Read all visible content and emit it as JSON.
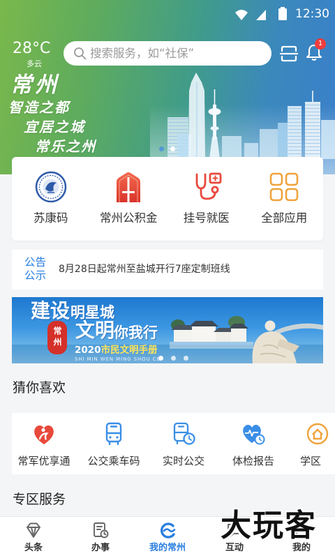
{
  "status_bar": {
    "time": "12:30",
    "icons": [
      "wifi-icon",
      "signal-icon",
      "battery-icon"
    ]
  },
  "header": {
    "temperature": "28°C",
    "weather": "多云",
    "search_placeholder": "搜索服务，如“社保”",
    "search_icon": "search-icon",
    "scan_icon": "scan-icon",
    "bell_icon": "bell-icon",
    "notification_count": "1"
  },
  "hero": {
    "title": "常州",
    "slogans": [
      "智造之都",
      "宜居之城",
      "常乐之州"
    ],
    "carousel": {
      "slides": 2,
      "active": 1
    }
  },
  "quick_apps": [
    {
      "label": "苏康码",
      "icon": "sukang-code-icon"
    },
    {
      "label": "常州公积金",
      "icon": "housing-fund-icon"
    },
    {
      "label": "挂号就医",
      "icon": "stethoscope-icon"
    },
    {
      "label": "全部应用",
      "icon": "all-apps-icon"
    }
  ],
  "notice": {
    "tag": [
      "公告",
      "公示"
    ],
    "text": "8月28日起常州至盐城开行7座定制班线"
  },
  "banner": {
    "headline_big_1": "建设",
    "headline_small_1": "明星城",
    "headline_big_2": "文明",
    "headline_small_2": "你我行",
    "seal": "常州",
    "year": "2020",
    "subtitle": "市民文明手册",
    "pinyin": "SHI MIN WEN MING SHOU CE",
    "carousel": {
      "slides": 3,
      "active": 0
    }
  },
  "guess": {
    "title": "猜你喜欢",
    "items": [
      {
        "label": "常军优享通",
        "icon": "military-heart-icon"
      },
      {
        "label": "公交乘车码",
        "icon": "bus-icon"
      },
      {
        "label": "实时公交",
        "icon": "realtime-bus-icon"
      },
      {
        "label": "体检报告",
        "icon": "health-report-icon"
      },
      {
        "label": "学区",
        "icon": "school-district-icon"
      }
    ]
  },
  "zone": {
    "title": "专区服务"
  },
  "tabbar": {
    "active": 2,
    "items": [
      {
        "label": "头条",
        "icon": "headline-icon"
      },
      {
        "label": "办事",
        "icon": "affairs-icon"
      },
      {
        "label": "我的常州",
        "icon": "changzhou-logo-icon"
      },
      {
        "label": "互动",
        "icon": "interaction-icon"
      },
      {
        "label": "我的",
        "icon": "profile-icon"
      }
    ]
  },
  "watermark": "大玩客",
  "colors": {
    "accent": "#2a7fe0",
    "badge": "#f03d3d",
    "page_bg": "#f4f5f7",
    "notice_tag": "#2a7fe0",
    "icon_red": "#e8493c",
    "icon_orange": "#f0a33c",
    "icon_blue": "#3a8ee6",
    "hero_green": "#7ab84b",
    "hero_blue": "#3a7fca",
    "banner_yellow": "#ffe45a"
  }
}
